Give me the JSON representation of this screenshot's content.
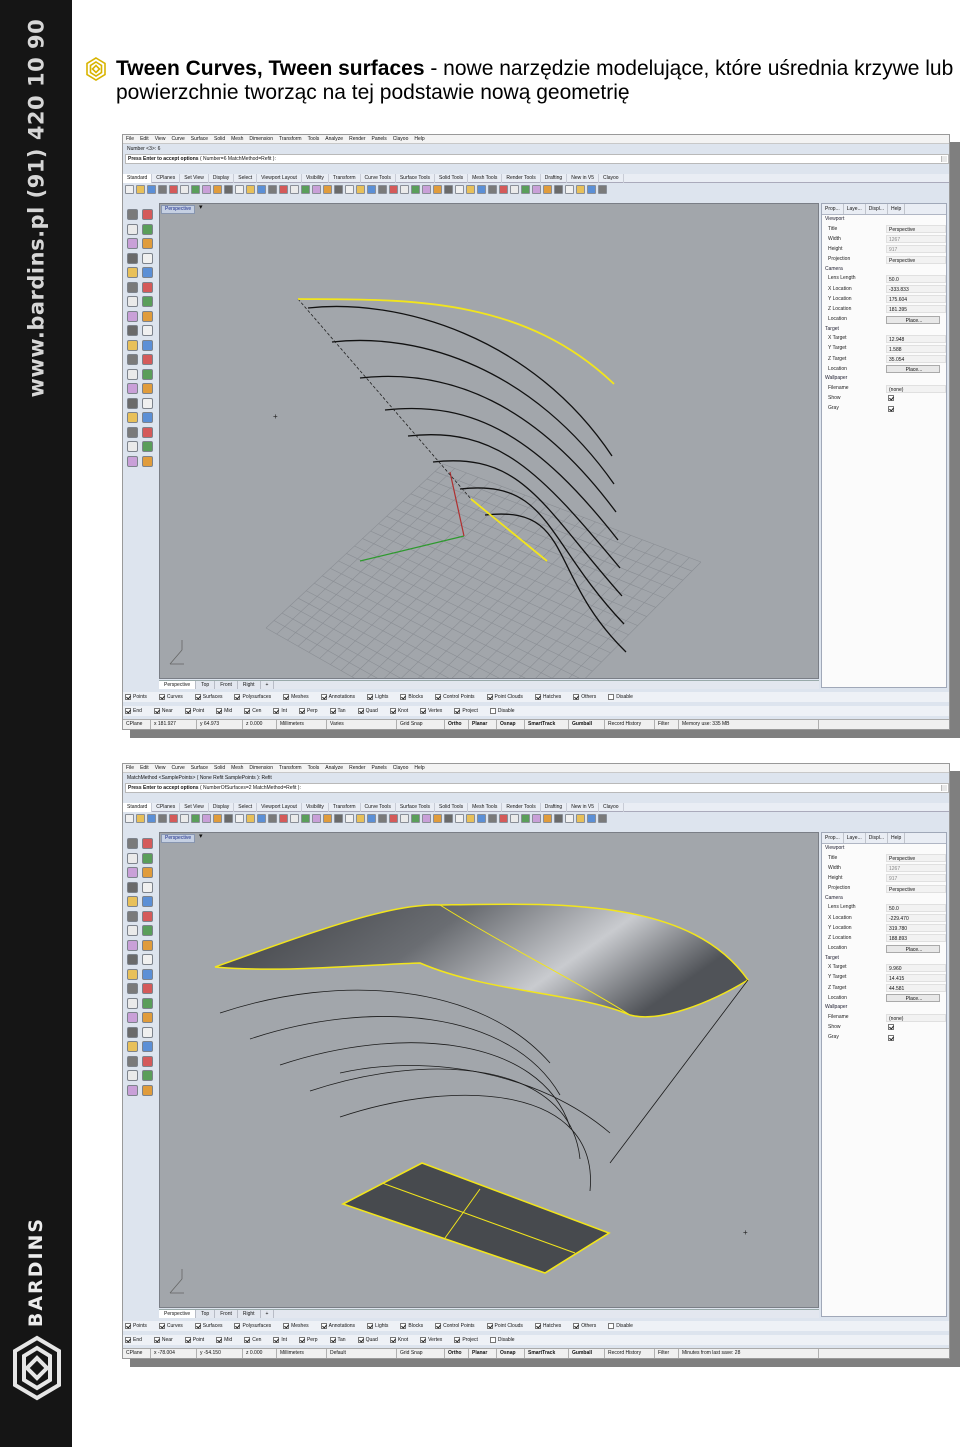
{
  "sidebar": {
    "url": "www.bardins.pl  (91) 420 10 90",
    "brand": "BARDINS",
    "logo_name": "bardins-logo"
  },
  "title": {
    "bold": "Tween Curves, Tween surfaces",
    "rest": " - nowe narzędzie modelujące, które uśrednia krzywe lub powierzchnie tworząc na tej podstawie nową geometrię"
  },
  "menu": [
    "File",
    "Edit",
    "View",
    "Curve",
    "Surface",
    "Solid",
    "Mesh",
    "Dimension",
    "Transform",
    "Tools",
    "Analyze",
    "Render",
    "Panels",
    "Clayoo",
    "Help"
  ],
  "toolbar_tabs": [
    "Standard",
    "CPlanes",
    "Set View",
    "Display",
    "Select",
    "Viewport Layout",
    "Visibility",
    "Transform",
    "Curve Tools",
    "Surface Tools",
    "Solid Tools",
    "Mesh Tools",
    "Render Tools",
    "Drafting",
    "New in V5",
    "Clayoo"
  ],
  "viewport_label": "Perspective",
  "viewport_tabs": [
    "Perspective",
    "Top",
    "Front",
    "Right",
    "+"
  ],
  "filters_row1": [
    "Points",
    "Curves",
    "Surfaces",
    "Polysurfaces",
    "Meshes",
    "Annotations",
    "Lights",
    "Blocks",
    "Control Points",
    "Point Clouds",
    "Hatches",
    "Others",
    "Disable"
  ],
  "osnap_row": [
    "End",
    "Near",
    "Point",
    "Mid",
    "Cen",
    "Int",
    "Perp",
    "Tan",
    "Quad",
    "Knot",
    "Vertex",
    "Project",
    "Disable"
  ],
  "panel_tabs": [
    "Prop...",
    "Laye...",
    "Displ...",
    "Help"
  ],
  "screens": [
    {
      "history": "Number <3>: 6",
      "prompt_bold": "Press Enter to accept options",
      "prompt_rest": " ( Number=6  MatchMethod=Refit ):",
      "panel": {
        "viewport": {
          "title": "Perspective",
          "width": "1267",
          "height": "917",
          "projection": "Perspective"
        },
        "camera": {
          "lens_length": "50.0",
          "x": "-333.833",
          "y": "175.604",
          "z": "181.395",
          "location_btn": "Place..."
        },
        "target": {
          "x": "12.948",
          "y": "1.588",
          "z": "35.054",
          "location_btn": "Place..."
        },
        "wallpaper": {
          "filename": "(none)",
          "show": true,
          "gray": true
        }
      },
      "status": {
        "cplane": "CPlane",
        "x": "x 181.927",
        "y": "y 64.973",
        "z": "z 0.000",
        "units": "Millimeters",
        "layer": "Varies",
        "grid": "Grid Snap",
        "ortho": "Ortho",
        "planar": "Planar",
        "osnap": "Osnap",
        "smarttrack": "SmartTrack",
        "gumball": "Gumball",
        "history": "Record History",
        "filter": "Filter",
        "memory": "Memory use: 335 MB"
      }
    },
    {
      "history": "MatchMethod <SamplePoints> ( None  Refit  SamplePoints ): Refit",
      "prompt_bold": "Press Enter to accept options",
      "prompt_rest": " ( NumberOfSurfaces=2  MatchMethod=Refit ):",
      "panel": {
        "viewport": {
          "title": "Perspective",
          "width": "1267",
          "height": "917",
          "projection": "Perspective"
        },
        "camera": {
          "lens_length": "50.0",
          "x": "-229.470",
          "y": "319.780",
          "z": "188.893",
          "location_btn": "Place..."
        },
        "target": {
          "x": "9.960",
          "y": "14.415",
          "z": "44.581",
          "location_btn": "Place..."
        },
        "wallpaper": {
          "filename": "(none)",
          "show": true,
          "gray": true
        }
      },
      "status": {
        "cplane": "CPlane",
        "x": "x -78.004",
        "y": "y -54.150",
        "z": "z 0.000",
        "units": "Millimeters",
        "layer": "Default",
        "grid": "Grid Snap",
        "ortho": "Ortho",
        "planar": "Planar",
        "osnap": "Osnap",
        "smarttrack": "SmartTrack",
        "gumball": "Gumball",
        "history": "Record History",
        "filter": "Filter",
        "memory": "Minutes from last save: 28"
      }
    }
  ],
  "panel_labels": {
    "viewport": "Viewport",
    "title": "Title",
    "width": "Width",
    "height": "Height",
    "projection": "Projection",
    "camera": "Camera",
    "lens_length": "Lens Length",
    "x_location": "X Location",
    "y_location": "Y Location",
    "z_location": "Z Location",
    "location": "Location",
    "target": "Target",
    "x_target": "X Target",
    "y_target": "Y Target",
    "z_target": "Z Target",
    "wallpaper": "Wallpaper",
    "filename": "Filename",
    "show": "Show",
    "gray": "Gray"
  },
  "colors": {
    "sidebar": "#151515",
    "viewport_bg": "#a2a6ab",
    "selection": "#f2e51c",
    "curve": "#111111",
    "ui_bg": "#dde4ee"
  }
}
